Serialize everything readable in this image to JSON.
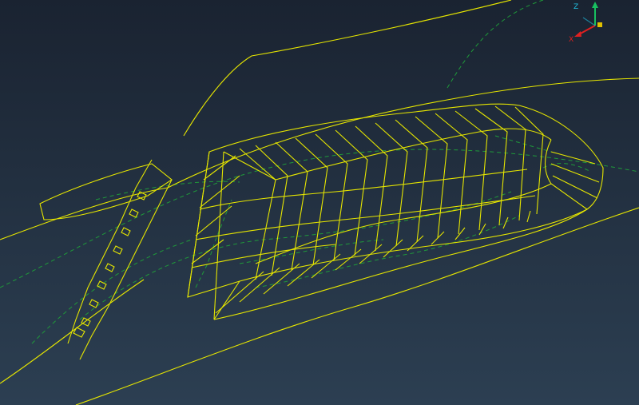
{
  "viewport": {
    "background_top": "#1a2331",
    "background_bottom": "#2c3f52"
  },
  "model": {
    "edge_color": "#e6e600",
    "hidden_edge_color": "#1f9a3a"
  },
  "triad": {
    "z_label": "Z",
    "x_label": "X",
    "z_color": "#18c060",
    "x_color": "#e02020",
    "y_color": "#20c0e0",
    "origin_color": "#e0c000"
  }
}
